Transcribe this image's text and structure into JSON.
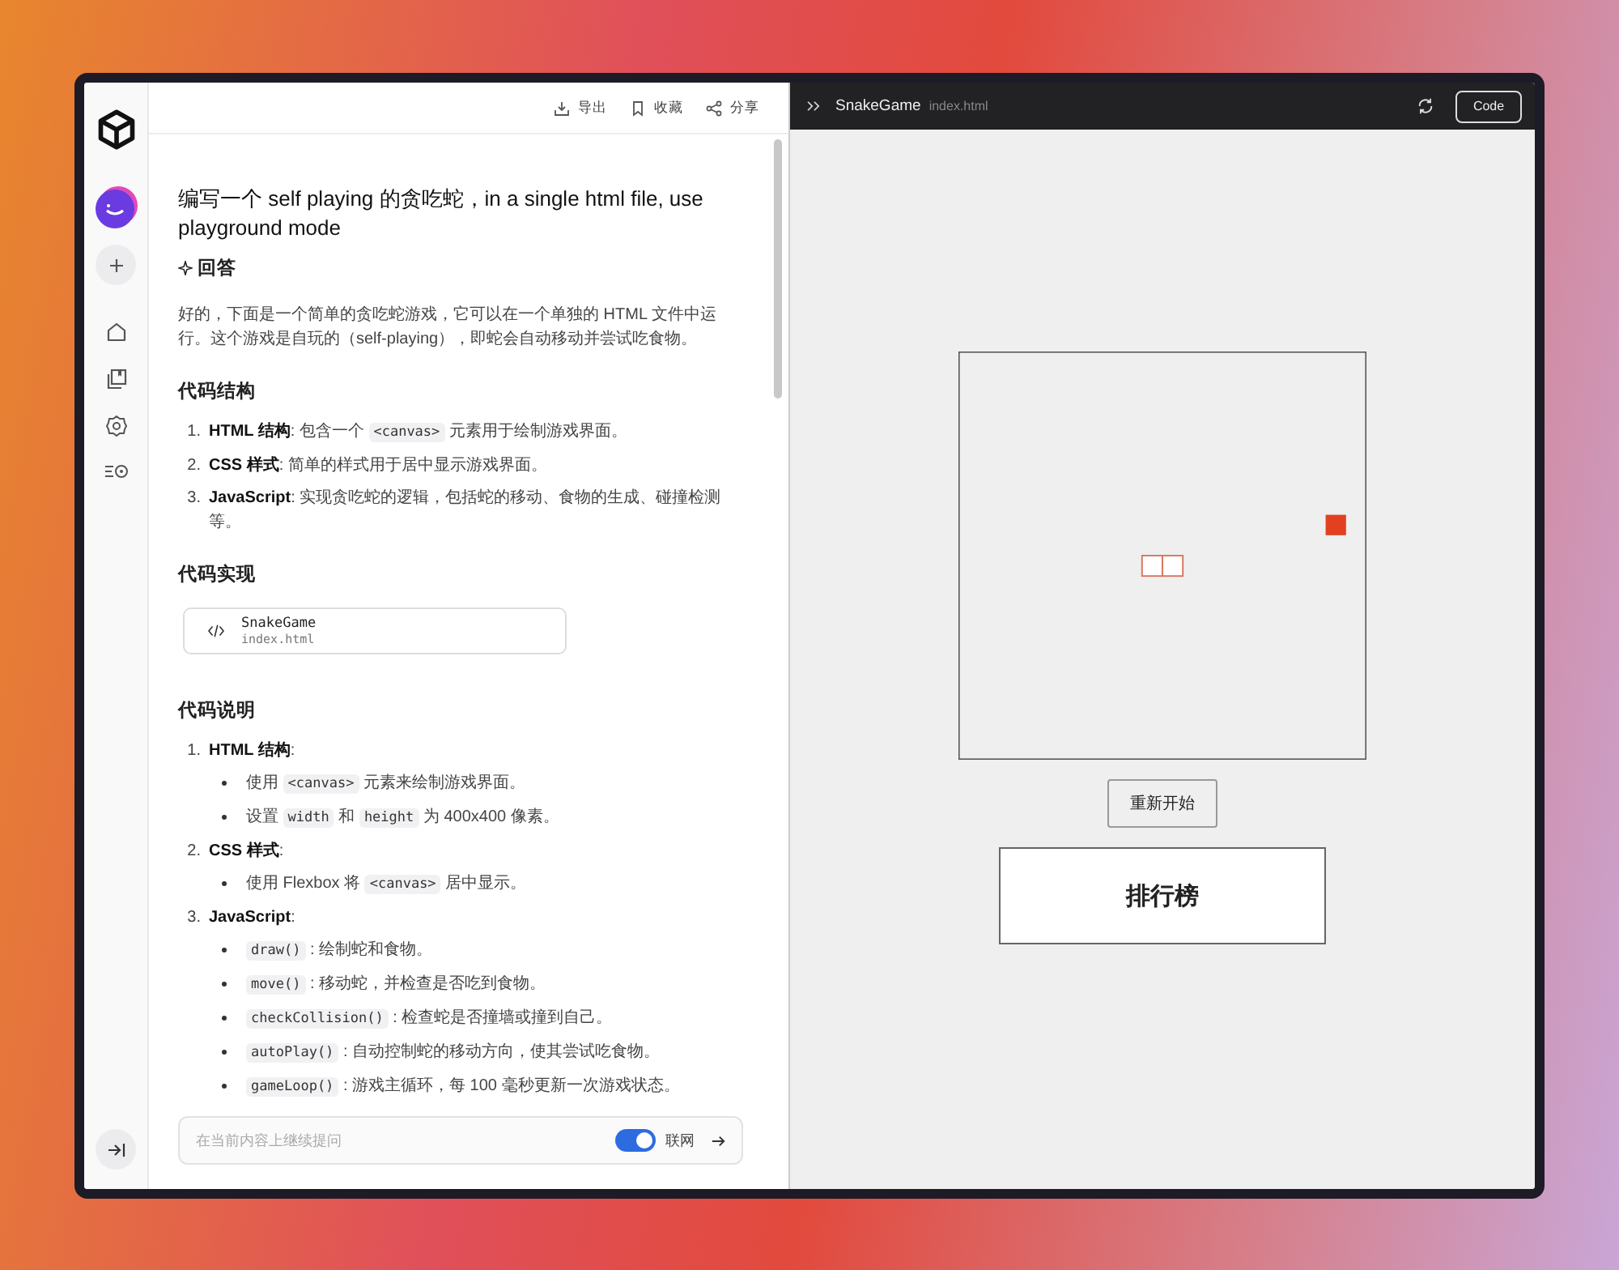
{
  "chat": {
    "toolbar": [
      {
        "kind": "download",
        "label": "导出"
      },
      {
        "kind": "bookmark",
        "label": "收藏"
      },
      {
        "kind": "share",
        "label": "分享"
      }
    ],
    "question": "编写一个 self playing 的贪吃蛇，in a single html file, use playground mode",
    "answer_heading": "回答",
    "intro": "好的，下面是一个简单的贪吃蛇游戏，它可以在一个单独的 HTML 文件中运行。这个游戏是自玩的（self-playing），即蛇会自动移动并尝试吃食物。",
    "sections": [
      {
        "heading": "代码结构",
        "items": [
          {
            "marker": "1.",
            "parts": [
              {
                "kind": "bold",
                "text": "HTML 结构"
              },
              {
                "kind": "plain",
                "text": ": 包含一个 "
              },
              {
                "kind": "code",
                "text": "<canvas>"
              },
              {
                "kind": "plain",
                "text": " 元素用于绘制游戏界面。"
              }
            ]
          },
          {
            "marker": "2.",
            "parts": [
              {
                "kind": "bold",
                "text": "CSS 样式"
              },
              {
                "kind": "plain",
                "text": ": 简单的样式用于居中显示游戏界面。"
              }
            ]
          },
          {
            "marker": "3.",
            "parts": [
              {
                "kind": "bold",
                "text": "JavaScript"
              },
              {
                "kind": "plain",
                "text": ": 实现贪吃蛇的逻辑，包括蛇的移动、食物的生成、碰撞检测等。"
              }
            ]
          }
        ]
      },
      {
        "heading": "代码实现",
        "file": {
          "name": "SnakeGame",
          "path": "index.html"
        }
      },
      {
        "heading": "代码说明",
        "items": [
          {
            "marker": "1.",
            "parts": [
              {
                "kind": "bold",
                "text": "HTML 结构"
              },
              {
                "kind": "plain",
                "text": ":"
              }
            ],
            "children": [
              {
                "parts": [
                  {
                    "kind": "plain",
                    "text": "使用 "
                  },
                  {
                    "kind": "code",
                    "text": "<canvas>"
                  },
                  {
                    "kind": "plain",
                    "text": " 元素来绘制游戏界面。"
                  }
                ]
              },
              {
                "parts": [
                  {
                    "kind": "plain",
                    "text": "设置 "
                  },
                  {
                    "kind": "code",
                    "text": "width"
                  },
                  {
                    "kind": "plain",
                    "text": " 和 "
                  },
                  {
                    "kind": "code",
                    "text": "height"
                  },
                  {
                    "kind": "plain",
                    "text": " 为 400x400 像素。"
                  }
                ]
              }
            ]
          },
          {
            "marker": "2.",
            "parts": [
              {
                "kind": "bold",
                "text": "CSS 样式"
              },
              {
                "kind": "plain",
                "text": ":"
              }
            ],
            "children": [
              {
                "parts": [
                  {
                    "kind": "plain",
                    "text": "使用 Flexbox 将 "
                  },
                  {
                    "kind": "code",
                    "text": "<canvas>"
                  },
                  {
                    "kind": "plain",
                    "text": " 居中显示。"
                  }
                ]
              }
            ]
          },
          {
            "marker": "3.",
            "parts": [
              {
                "kind": "bold",
                "text": "JavaScript"
              },
              {
                "kind": "plain",
                "text": ":"
              }
            ],
            "children": [
              {
                "parts": [
                  {
                    "kind": "code",
                    "text": "draw()"
                  },
                  {
                    "kind": "plain",
                    "text": " : 绘制蛇和食物。"
                  }
                ]
              },
              {
                "parts": [
                  {
                    "kind": "code",
                    "text": "move()"
                  },
                  {
                    "kind": "plain",
                    "text": " : 移动蛇，并检查是否吃到食物。"
                  }
                ]
              },
              {
                "parts": [
                  {
                    "kind": "code",
                    "text": "checkCollision()"
                  },
                  {
                    "kind": "plain",
                    "text": " : 检查蛇是否撞墙或撞到自己。"
                  }
                ]
              },
              {
                "parts": [
                  {
                    "kind": "code",
                    "text": "autoPlay()"
                  },
                  {
                    "kind": "plain",
                    "text": " : 自动控制蛇的移动方向，使其尝试吃食物。"
                  }
                ]
              },
              {
                "parts": [
                  {
                    "kind": "code",
                    "text": "gameLoop()"
                  },
                  {
                    "kind": "plain",
                    "text": " : 游戏主循环，每 100 毫秒更新一次游戏状态。"
                  }
                ]
              }
            ]
          }
        ]
      }
    ],
    "input": {
      "placeholder": "在当前内容上继续提问",
      "web_search": {
        "label": "联网",
        "on": true
      }
    }
  },
  "preview": {
    "title": "SnakeGame",
    "file": "index.html",
    "code_button": "Code",
    "restart_button": "重新开始",
    "leaderboard": "排行榜"
  }
}
